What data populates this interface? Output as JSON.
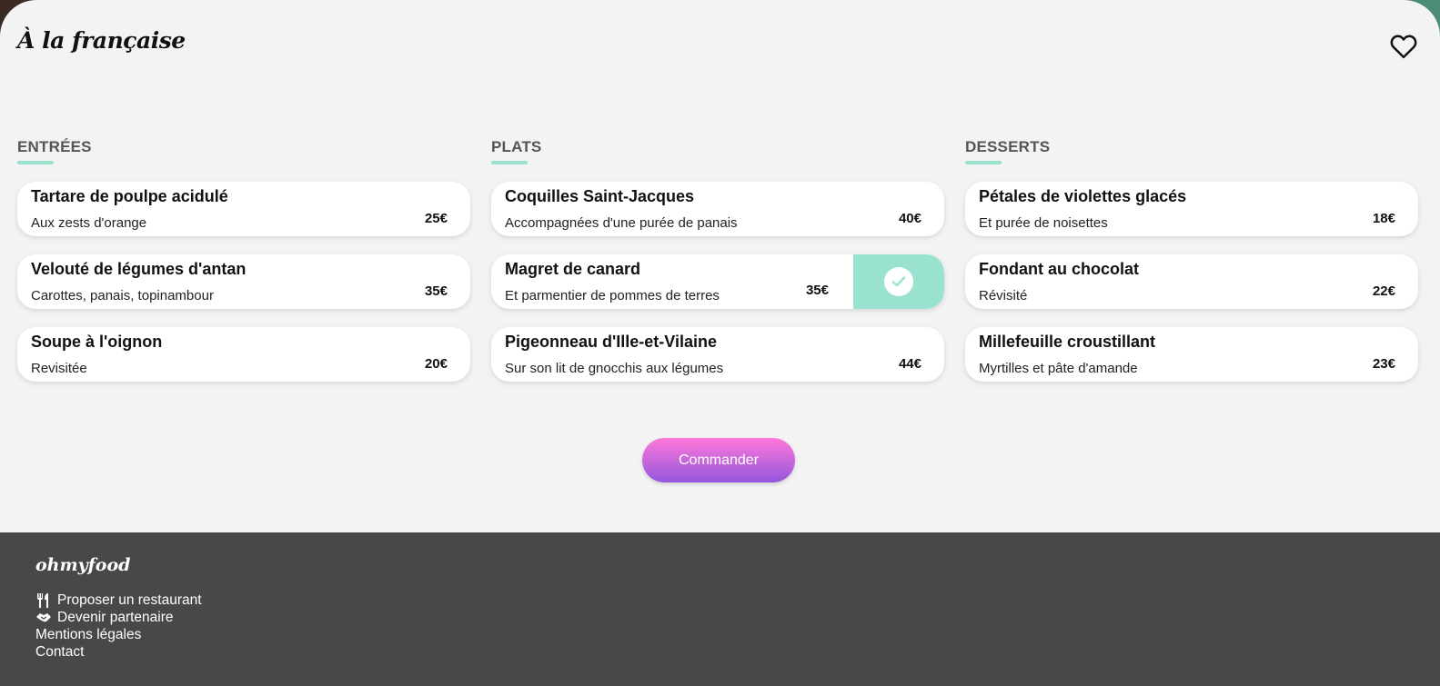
{
  "header": {
    "title": "À la française",
    "favorite_icon": "heart-outline-icon"
  },
  "menu": {
    "columns": [
      {
        "title": "ENTRÉES",
        "items": [
          {
            "name": "Tartare de poulpe acidulé",
            "desc": "Aux zests d'orange",
            "price": "25€"
          },
          {
            "name": "Velouté de légumes d'antan",
            "desc": "Carottes, panais, topinambour",
            "price": "35€"
          },
          {
            "name": "Soupe à l'oignon",
            "desc": "Revisitée",
            "price": "20€"
          }
        ]
      },
      {
        "title": "PLATS",
        "items": [
          {
            "name": "Coquilles Saint-Jacques",
            "desc": "Accompagnées d'une purée de panais",
            "price": "40€"
          },
          {
            "name": "Magret de canard",
            "desc": "Et parmentier de pommes de terres",
            "price": "35€",
            "selected": true
          },
          {
            "name": "Pigeonneau d'Ille-et-Vilaine",
            "desc": "Sur son lit de gnocchis aux légumes",
            "price": "44€"
          }
        ]
      },
      {
        "title": "DESSERTS",
        "items": [
          {
            "name": "Pétales de violettes glacés",
            "desc": "Et purée de noisettes",
            "price": "18€"
          },
          {
            "name": "Fondant au chocolat",
            "desc": "Révisité",
            "price": "22€"
          },
          {
            "name": "Millefeuille croustillant",
            "desc": "Myrtilles et pâte d'amande",
            "price": "23€"
          }
        ]
      }
    ]
  },
  "order_button": {
    "label": "Commander"
  },
  "footer": {
    "logo": "ohmyfood",
    "links": [
      {
        "label": "Proposer un restaurant",
        "icon": "utensils-icon"
      },
      {
        "label": "Devenir partenaire",
        "icon": "handshake-icon"
      },
      {
        "label": "Mentions légales"
      },
      {
        "label": "Contact"
      }
    ]
  },
  "colors": {
    "accent": "#99e2d0",
    "button_gradient_top": "#ff79da",
    "button_gradient_bottom": "#9356dc",
    "footer_bg": "#484848",
    "page_bg": "#f3f3f3"
  }
}
